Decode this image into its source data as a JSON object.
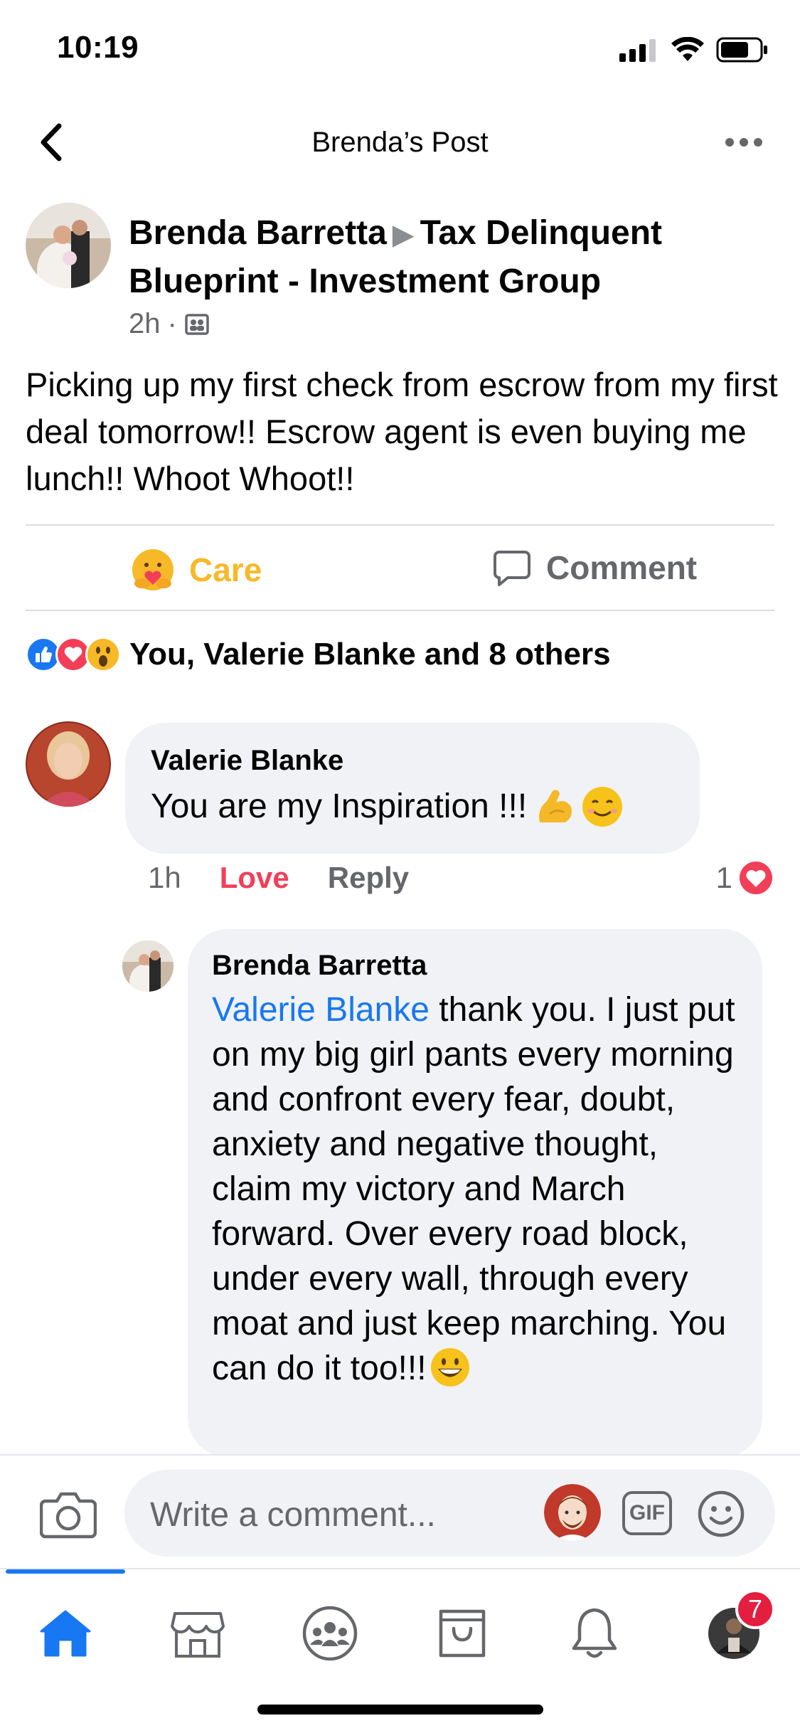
{
  "status_bar": {
    "time": "10:19",
    "icons": [
      "signal-icon",
      "wifi-icon",
      "battery-icon"
    ]
  },
  "header": {
    "title": "Brenda’s Post",
    "back_icon": "chevron-left-icon",
    "more_icon": "more-icon"
  },
  "post": {
    "author": "Brenda Barretta",
    "group": "Tax Delinquent Blueprint - Investment Group",
    "time": "2h",
    "privacy_icon": "group-icon",
    "text": "Picking up my first check from escrow from my first deal tomorrow!! Escrow agent is even buying me lunch!! Whoot Whoot!!"
  },
  "actions": {
    "care_label": "Care",
    "comment_label": "Comment"
  },
  "reactions": {
    "icons": [
      "like-icon",
      "love-icon",
      "wow-icon"
    ],
    "summary": "You, Valerie Blanke and 8 others"
  },
  "comments": [
    {
      "author": "Valerie Blanke",
      "text": "You are my Inspiration !!!",
      "emojis": [
        "flexed-biceps-emoji",
        "smiling-face-emoji"
      ],
      "time": "1h",
      "love_label": "Love",
      "reply_label": "Reply",
      "reaction_count": "1"
    }
  ],
  "reply": {
    "author": "Brenda Barretta",
    "mention": "Valerie Blanke",
    "text": " thank you. I just put on my big girl pants every morning and confront every fear, doubt, anxiety and negative thought, claim my victory and March forward. Over every road block, under every wall, through every moat and just keep marching. You can do it too!!!",
    "emoji": "grinning-face-emoji"
  },
  "composer": {
    "placeholder": "Write a comment...",
    "gif_label": "GIF"
  },
  "tab_bar": {
    "tabs": [
      "home-icon",
      "marketplace-icon",
      "groups-icon",
      "shop-icon",
      "notifications-icon",
      "profile-avatar"
    ],
    "active": "home",
    "badge": "7"
  },
  "colors": {
    "accent": "#1877f2",
    "care": "#f7b928",
    "love": "#f33e58",
    "badge": "#e41e3f"
  }
}
